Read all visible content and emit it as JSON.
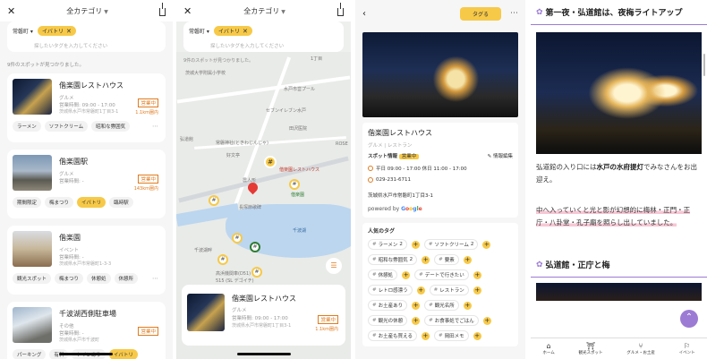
{
  "common": {
    "category_title": "全カテゴリ",
    "area_filter": "常磐町",
    "active_tag": "イバトリ",
    "tag_placeholder": "探したいタグを入力してください",
    "result_count": "9件のスポットが見つかりました。"
  },
  "list": {
    "cards": [
      {
        "name": "偕楽園レストハウス",
        "genre": "グルメ",
        "hours": "営業時間: 09:00 - 17:00",
        "address": "茨城県水戸市常磐町1丁目3-1",
        "status": "営業中",
        "distance": "1.1km圏内",
        "tags": [
          "ラーメン",
          "ソフトクリーム",
          "昭和な雰囲気"
        ]
      },
      {
        "name": "偕楽園駅",
        "genre": "グルメ",
        "hours": "営業時間: -",
        "address": "",
        "status": "営業中",
        "distance": "143km圏内",
        "tags": [
          "期間限定",
          "梅まつり",
          "イバトリ",
          "臨時駅"
        ]
      },
      {
        "name": "偕楽園",
        "genre": "イベント",
        "hours": "営業時間: -",
        "address": "茨城県水戸市常磐町1-3-3",
        "status": "",
        "distance": "",
        "tags": [
          "観光スポット",
          "梅まつり",
          "休憩処",
          "休憩所"
        ]
      },
      {
        "name": "千波湖西側駐車場",
        "genre": "その他",
        "hours": "営業時間: -",
        "address": "茨城県水戸市千波町",
        "status": "営業中",
        "distance": "",
        "tags": [
          "パーキング",
          "有料",
          "トイレあり",
          "イバトリ"
        ]
      }
    ]
  },
  "map": {
    "labels": [
      "1丁目",
      "茨城大学附属小学校",
      "水戸市営プール",
      "セブンイレブン水戸",
      "常磐神社(ときわじんじゃ)",
      "偕楽園レストハウス",
      "好文亭",
      "農人形",
      "偕楽園",
      "千波湖",
      "長塚節歌碑",
      "千波湖畔",
      "高浜機関車(D51)",
      "515 (SL デゴイチ)",
      "弘道館",
      "田沢医院",
      "ROSE"
    ],
    "card": {
      "name": "偕楽園レストハウス",
      "genre": "グルメ",
      "hours": "営業時間: 09:00 - 17:00",
      "address": "茨城県水戸市常磐町1丁目3-1",
      "status": "営業中",
      "distance": "1.1km圏内"
    }
  },
  "detail": {
    "tag_button": "タグる",
    "name": "偕楽園レストハウス",
    "genre": "グルメ | レストラン",
    "info_label": "スポット情報",
    "status": "営業中",
    "edit_label": "情報編集",
    "hours": "平日 09:00 - 17:00 休日 11:00 - 17:00",
    "phone": "029-231-6711",
    "address": "茨城県水戸市常磐町1丁目3-1",
    "powered_by": "powered by",
    "google": [
      "G",
      "o",
      "o",
      "g",
      "l",
      "e"
    ],
    "popular_tags_title": "人気のタグ",
    "tag_rows": [
      [
        {
          "t": "ラーメン",
          "n": "2"
        },
        {
          "t": "ソフトクリーム",
          "n": "2"
        }
      ],
      [
        {
          "t": "昭和な雰囲気",
          "n": "2"
        },
        {
          "t": "要素",
          "n": ""
        }
      ],
      [
        {
          "t": "休憩処",
          "n": ""
        },
        {
          "t": "デートで行きたい",
          "n": ""
        }
      ],
      [
        {
          "t": "レトロ感漂う",
          "n": ""
        },
        {
          "t": "レストラン",
          "n": ""
        }
      ],
      [
        {
          "t": "お土産あり",
          "n": ""
        },
        {
          "t": "観光名所",
          "n": ""
        }
      ],
      [
        {
          "t": "観光の休憩",
          "n": ""
        },
        {
          "t": "お食事処でごはん",
          "n": ""
        }
      ],
      [
        {
          "t": "お土産も買える",
          "n": ""
        },
        {
          "t": "岡田メモ",
          "n": ""
        }
      ]
    ]
  },
  "article": {
    "heading1": "第一夜・弘道館は、夜梅ライトアップ",
    "para1_pre": "弘道館の入り口には",
    "para1_bold": "水戸の水府提灯",
    "para1_post": "でみなさんをお出迎え。",
    "para2": "中へ入っていくと光と影が幻想的に梅林・正門・正庁・八卦堂・孔子廟を照らし出していました。",
    "heading2": "弘道館・正庁と梅",
    "tabs": [
      {
        "icon": "home-icon",
        "label": "ホーム"
      },
      {
        "icon": "spot-icon",
        "label": "観光スポット"
      },
      {
        "icon": "food-icon",
        "label": "グルメ・お土産"
      },
      {
        "icon": "event-icon",
        "label": "イベント"
      }
    ]
  }
}
